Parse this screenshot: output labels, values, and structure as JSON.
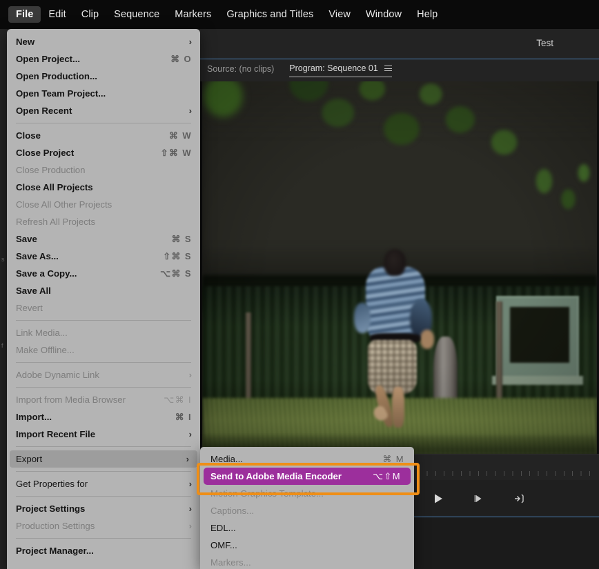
{
  "app": {
    "project_title": "Test"
  },
  "menubar": {
    "items": [
      {
        "label": "File",
        "active": true
      },
      {
        "label": "Edit",
        "active": false
      },
      {
        "label": "Clip",
        "active": false
      },
      {
        "label": "Sequence",
        "active": false
      },
      {
        "label": "Markers",
        "active": false
      },
      {
        "label": "Graphics and Titles",
        "active": false
      },
      {
        "label": "View",
        "active": false
      },
      {
        "label": "Window",
        "active": false
      },
      {
        "label": "Help",
        "active": false
      }
    ]
  },
  "panel_tabs": {
    "source": "Source: (no clips)",
    "program": "Program: Sequence 01",
    "menu_icon": "hamburger-icon"
  },
  "file_menu": {
    "items": [
      {
        "label": "New",
        "shortcut": "",
        "arrow": "›",
        "enabled": true,
        "bold": true
      },
      {
        "label": "Open Project...",
        "shortcut": "⌘ O",
        "arrow": "",
        "enabled": true,
        "bold": true
      },
      {
        "label": "Open Production...",
        "shortcut": "",
        "arrow": "",
        "enabled": true,
        "bold": true
      },
      {
        "label": "Open Team Project...",
        "shortcut": "",
        "arrow": "",
        "enabled": true,
        "bold": true
      },
      {
        "label": "Open Recent",
        "shortcut": "",
        "arrow": "›",
        "enabled": true,
        "bold": true
      },
      {
        "separator": true
      },
      {
        "label": "Close",
        "shortcut": "⌘ W",
        "arrow": "",
        "enabled": true,
        "bold": true
      },
      {
        "label": "Close Project",
        "shortcut": "⇧⌘ W",
        "arrow": "",
        "enabled": true,
        "bold": true
      },
      {
        "label": "Close Production",
        "shortcut": "",
        "arrow": "",
        "enabled": false,
        "bold": false
      },
      {
        "label": "Close All Projects",
        "shortcut": "",
        "arrow": "",
        "enabled": true,
        "bold": true
      },
      {
        "label": "Close All Other Projects",
        "shortcut": "",
        "arrow": "",
        "enabled": false,
        "bold": false
      },
      {
        "label": "Refresh All Projects",
        "shortcut": "",
        "arrow": "",
        "enabled": false,
        "bold": false
      },
      {
        "label": "Save",
        "shortcut": "⌘ S",
        "arrow": "",
        "enabled": true,
        "bold": true
      },
      {
        "label": "Save As...",
        "shortcut": "⇧⌘ S",
        "arrow": "",
        "enabled": true,
        "bold": true
      },
      {
        "label": "Save a Copy...",
        "shortcut": "⌥⌘ S",
        "arrow": "",
        "enabled": true,
        "bold": true
      },
      {
        "label": "Save All",
        "shortcut": "",
        "arrow": "",
        "enabled": true,
        "bold": true
      },
      {
        "label": "Revert",
        "shortcut": "",
        "arrow": "",
        "enabled": false,
        "bold": false
      },
      {
        "separator": true
      },
      {
        "label": "Link Media...",
        "shortcut": "",
        "arrow": "",
        "enabled": false,
        "bold": false
      },
      {
        "label": "Make Offline...",
        "shortcut": "",
        "arrow": "",
        "enabled": false,
        "bold": false
      },
      {
        "separator": true
      },
      {
        "label": "Adobe Dynamic Link",
        "shortcut": "",
        "arrow": "›",
        "enabled": false,
        "bold": false
      },
      {
        "separator": true
      },
      {
        "label": "Import from Media Browser",
        "shortcut": "⌥⌘ I",
        "arrow": "",
        "enabled": false,
        "bold": false
      },
      {
        "label": "Import...",
        "shortcut": "⌘ I",
        "arrow": "",
        "enabled": true,
        "bold": true
      },
      {
        "label": "Import Recent File",
        "shortcut": "",
        "arrow": "›",
        "enabled": true,
        "bold": true
      },
      {
        "separator": true
      },
      {
        "label": "Export",
        "shortcut": "",
        "arrow": "›",
        "enabled": true,
        "bold": false,
        "highlighted": true
      },
      {
        "separator": true
      },
      {
        "label": "Get Properties for",
        "shortcut": "",
        "arrow": "›",
        "enabled": true,
        "bold": false
      },
      {
        "separator": true
      },
      {
        "label": "Project Settings",
        "shortcut": "",
        "arrow": "›",
        "enabled": true,
        "bold": true
      },
      {
        "label": "Production Settings",
        "shortcut": "",
        "arrow": "›",
        "enabled": false,
        "bold": false
      },
      {
        "separator": true
      },
      {
        "label": "Project Manager...",
        "shortcut": "",
        "arrow": "",
        "enabled": true,
        "bold": true
      }
    ]
  },
  "export_submenu": {
    "items": [
      {
        "label": "Media...",
        "shortcut": "⌘ M",
        "enabled": true,
        "selected": false
      },
      {
        "label": "Send to Adobe Media Encoder",
        "shortcut": "⌥⇧M",
        "enabled": true,
        "selected": true
      },
      {
        "label": "Motion Graphics Template...",
        "shortcut": "",
        "enabled": false,
        "selected": false
      },
      {
        "label": "Captions...",
        "shortcut": "",
        "enabled": false,
        "selected": false
      },
      {
        "label": "EDL...",
        "shortcut": "",
        "enabled": true,
        "selected": false
      },
      {
        "label": "OMF...",
        "shortcut": "",
        "enabled": true,
        "selected": false
      },
      {
        "label": "Markers...",
        "shortcut": "",
        "enabled": false,
        "selected": false
      }
    ]
  },
  "transport": {
    "buttons": [
      {
        "name": "mark-in-icon",
        "glyph": "mark-in"
      },
      {
        "name": "mark-out-icon",
        "glyph": "mark-out"
      },
      {
        "name": "go-to-in-icon",
        "glyph": "go-to-in"
      },
      {
        "name": "step-back-icon",
        "glyph": "step-back"
      },
      {
        "name": "play-icon",
        "glyph": "play"
      },
      {
        "name": "step-forward-icon",
        "glyph": "step-forward"
      },
      {
        "name": "go-to-out-icon",
        "glyph": "go-to-out"
      }
    ]
  },
  "colors": {
    "accent_purple": "#9c2f9c",
    "annotation_orange": "#ef8e16",
    "playhead_blue": "#2b7cd3",
    "menu_grey": "#b4b4b4",
    "panel_dark": "#1b1b1b"
  },
  "sliver": {
    "ghost_a": "s",
    "ghost_b": "f"
  }
}
